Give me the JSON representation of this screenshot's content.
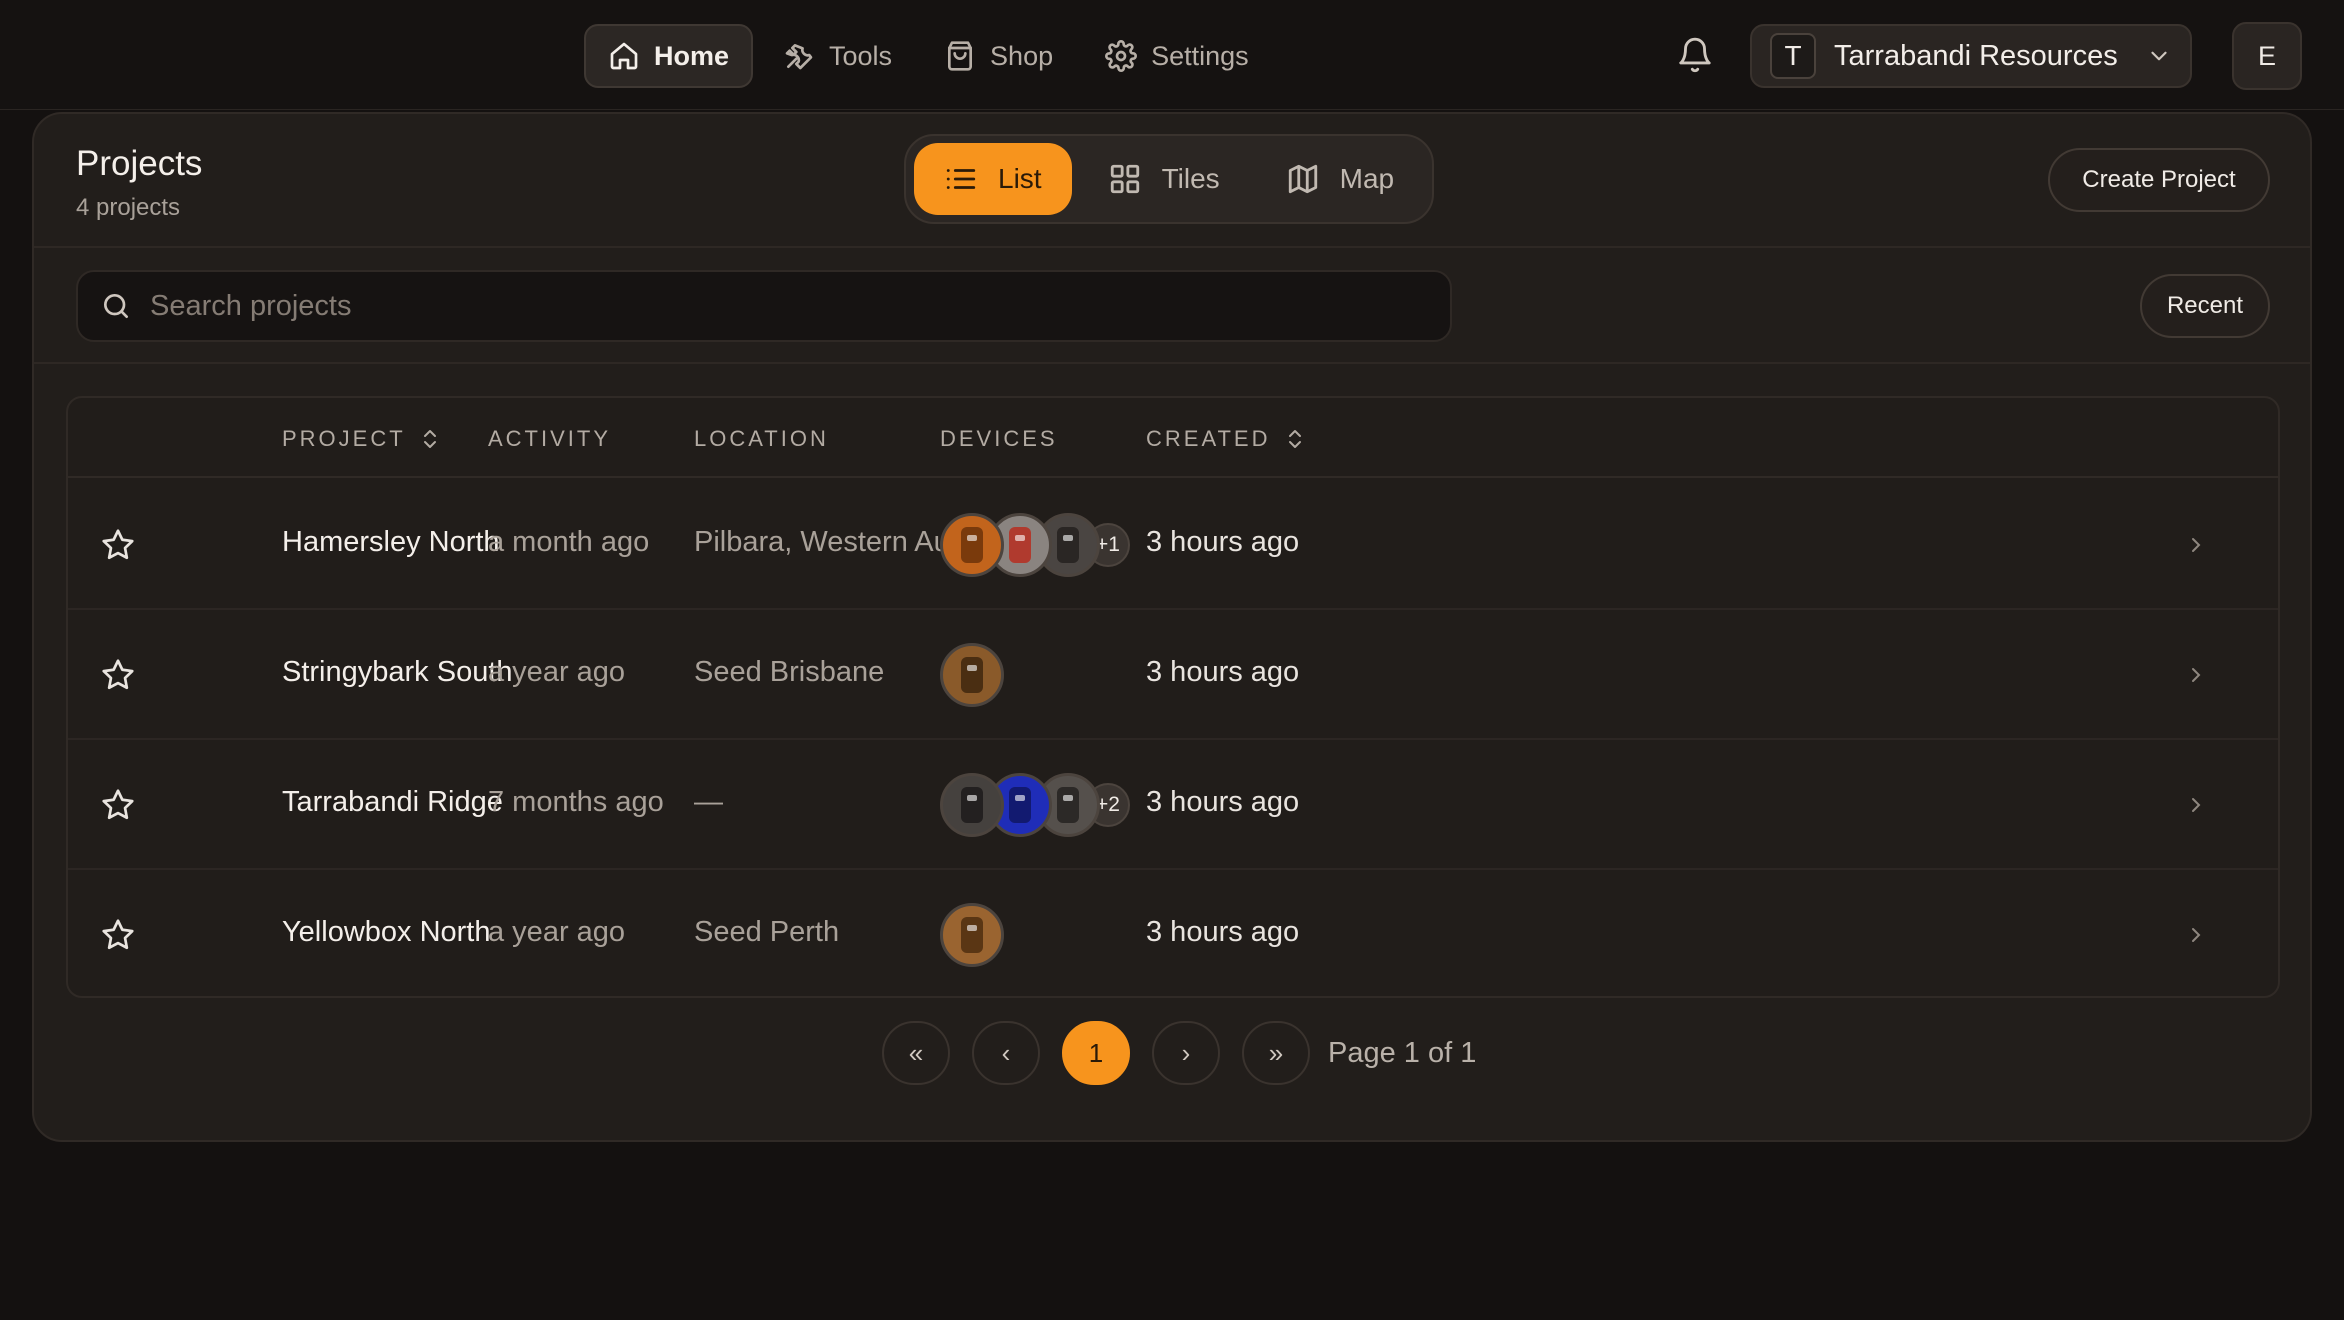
{
  "nav": {
    "items": [
      {
        "label": "Home",
        "icon": "home-icon",
        "active": true
      },
      {
        "label": "Tools",
        "icon": "wrench-icon",
        "active": false
      },
      {
        "label": "Shop",
        "icon": "shopping-bag-icon",
        "active": false
      },
      {
        "label": "Settings",
        "icon": "gear-icon",
        "active": false
      }
    ]
  },
  "org": {
    "initial": "T",
    "name": "Tarrabandi Resources"
  },
  "user": {
    "initial": "E"
  },
  "header": {
    "title": "Projects",
    "count": "4 projects",
    "views": [
      {
        "label": "List",
        "icon": "list-icon",
        "active": true
      },
      {
        "label": "Tiles",
        "icon": "grid-icon",
        "active": false
      },
      {
        "label": "Map",
        "icon": "map-icon",
        "active": false
      }
    ],
    "create_label": "Create Project"
  },
  "search": {
    "placeholder": "Search projects",
    "value": ""
  },
  "sort": {
    "recent_label": "Recent"
  },
  "table": {
    "columns": {
      "project": "PROJECT",
      "activity": "ACTIVITY",
      "location": "LOCATION",
      "devices": "DEVICES",
      "created": "CREATED"
    },
    "rows": [
      {
        "name": "Hamersley North",
        "activity": "a month ago",
        "location": "Pilbara, Western Australia",
        "devices": [
          "#c2641c",
          "#8a8480",
          "#4a4542"
        ],
        "devices_more": "+1",
        "created": "3 hours ago"
      },
      {
        "name": "Stringybark South",
        "activity": "a year ago",
        "location": "Seed Brisbane",
        "devices": [
          "#8a5a2a"
        ],
        "devices_more": "",
        "created": "3 hours ago"
      },
      {
        "name": "Tarrabandi Ridge",
        "activity": "7 months ago",
        "location": "—",
        "devices": [
          "#45413e",
          "#1f2db8",
          "#55504c"
        ],
        "devices_more": "+2",
        "created": "3 hours ago"
      },
      {
        "name": "Yellowbox North",
        "activity": "a year ago",
        "location": "Seed Perth",
        "devices": [
          "#9a6430"
        ],
        "devices_more": "",
        "created": "3 hours ago"
      }
    ]
  },
  "pagination": {
    "first": "«",
    "prev": "‹",
    "current": "1",
    "next": "›",
    "last": "»",
    "label": "Page 1 of 1"
  },
  "colors": {
    "accent": "#f7941d",
    "background": "#141110",
    "card": "#221e1b"
  }
}
